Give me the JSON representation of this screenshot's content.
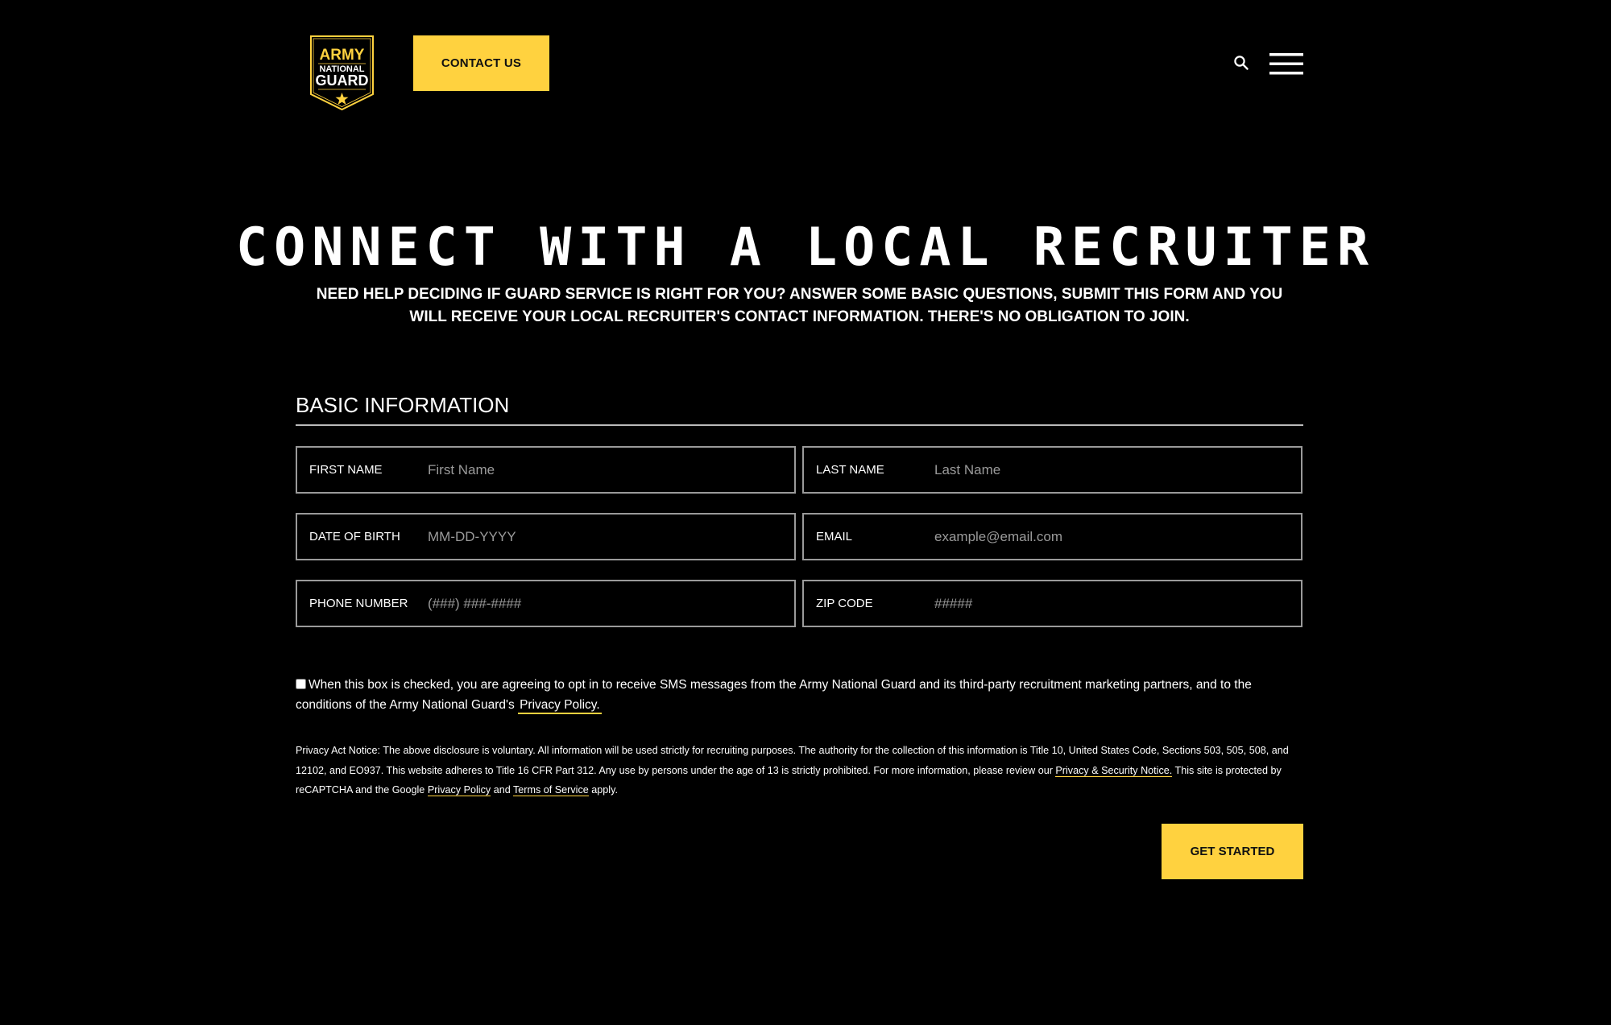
{
  "header": {
    "logo": {
      "line1": "ARMY",
      "line2": "NATIONAL",
      "line3": "GUARD",
      "icon": "star-icon"
    },
    "contact_label": "CONTACT US",
    "icons": [
      "search-icon",
      "hamburger-menu-icon"
    ]
  },
  "hero": {
    "title": "CONNECT WITH A LOCAL RECRUITER",
    "subtitle": "NEED HELP DECIDING IF GUARD SERVICE IS RIGHT FOR YOU? ANSWER SOME BASIC QUESTIONS, SUBMIT THIS FORM AND YOU WILL RECEIVE YOUR LOCAL RECRUITER'S CONTACT INFORMATION. THERE'S NO OBLIGATION TO JOIN."
  },
  "form": {
    "section_title": "BASIC INFORMATION",
    "fields": [
      {
        "label": "FIRST NAME",
        "placeholder": "First Name",
        "value": ""
      },
      {
        "label": "LAST NAME",
        "placeholder": "Last Name",
        "value": ""
      },
      {
        "label": "DATE OF BIRTH",
        "placeholder": "MM-DD-YYYY",
        "value": ""
      },
      {
        "label": "EMAIL",
        "placeholder": "example@email.com",
        "value": ""
      },
      {
        "label": "PHONE NUMBER",
        "placeholder": "(###) ###-####",
        "value": ""
      },
      {
        "label": "ZIP CODE",
        "placeholder": "#####",
        "value": ""
      }
    ],
    "sms_consent": {
      "checked": false,
      "text": "When this box is checked, you are agreeing to opt in to receive SMS messages from the Army National Guard and its third-party recruitment marketing partners, and to the conditions of the Army National Guard's ",
      "link_label": "Privacy Policy."
    },
    "privacy_notice": {
      "text_1": "Privacy Act Notice: The above disclosure is voluntary. All information will be used strictly for recruiting purposes. The authority for the collection of this information is Title 10, United States Code, Sections 503, 505, 508, and 12102, and EO937. This website adheres to Title 16 CFR Part 312. Any use by persons under the age of 13 is strictly prohibited. For more information, please review our ",
      "link_1": "Privacy & Security Notice.",
      "text_2": " This site is protected by reCAPTCHA and the Google ",
      "link_2": "Privacy Policy",
      "text_3": " and ",
      "link_3": "Terms of Service",
      "text_4": " apply."
    },
    "submit_label": "GET STARTED"
  },
  "colors": {
    "background": "#000000",
    "accent": "#ffd23f",
    "field_border": "#9a9a9a",
    "text": "#ffffff"
  }
}
